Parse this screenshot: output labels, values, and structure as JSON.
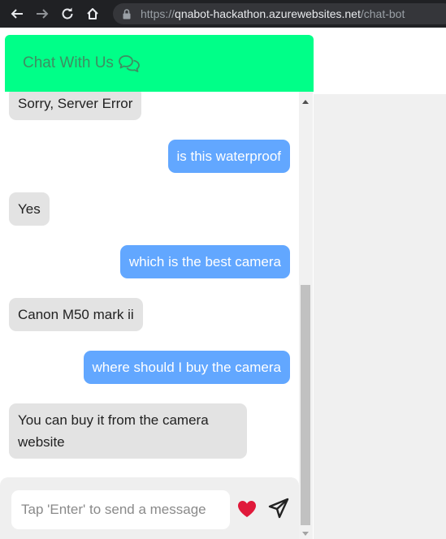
{
  "browser": {
    "url_host": "qnabot-hackathon.azurewebsites.net",
    "url_path": "/chat-bot",
    "url_scheme": "https://"
  },
  "chat": {
    "title": "Chat With Us",
    "header_color": "#00ff88",
    "messages": [
      {
        "sender": "bot",
        "text": "Sorry, Server Error"
      },
      {
        "sender": "user",
        "text": "is this waterproof"
      },
      {
        "sender": "bot",
        "text": "Yes"
      },
      {
        "sender": "user",
        "text": "which is the best camera"
      },
      {
        "sender": "bot",
        "text": "Canon M50 mark ii"
      },
      {
        "sender": "user",
        "text": "where should I buy the camera"
      },
      {
        "sender": "bot",
        "text": "You can buy it from the camera website"
      }
    ],
    "input": {
      "placeholder": "Tap 'Enter' to send a message",
      "value": ""
    }
  },
  "icons": {
    "back": "arrow-left-icon",
    "forward": "arrow-right-icon",
    "reload": "reload-icon",
    "home": "home-icon",
    "lock": "lock-icon",
    "chat": "chat-bubbles-icon",
    "heart": "heart-icon",
    "send": "send-icon"
  },
  "colors": {
    "user_bubble": "#62a7ff",
    "bot_bubble": "#e3e3e3",
    "heart": "#e0193a"
  }
}
